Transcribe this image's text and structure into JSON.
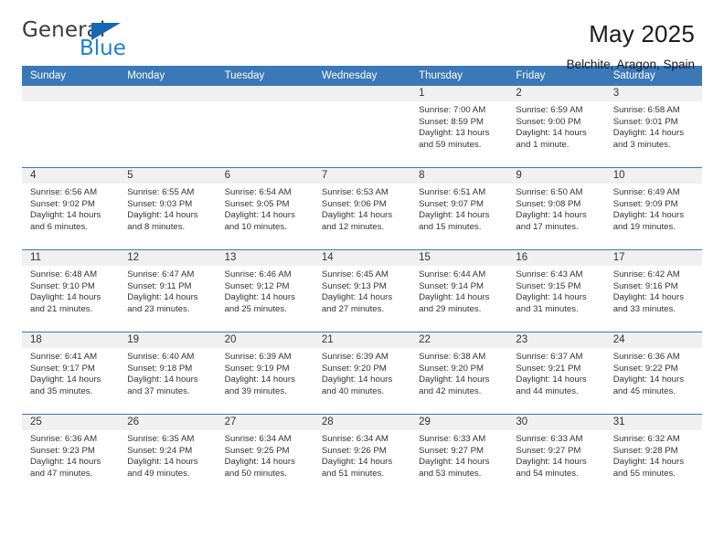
{
  "brand": {
    "name_top": "General",
    "name_bottom": "Blue",
    "accent_color": "#1567b3"
  },
  "header": {
    "title": "May 2025",
    "subtitle": "Belchite, Aragon, Spain"
  },
  "calendar": {
    "header_bg": "#3b78b7",
    "daynum_bg": "#f0f0f0",
    "weekdays": [
      "Sunday",
      "Monday",
      "Tuesday",
      "Wednesday",
      "Thursday",
      "Friday",
      "Saturday"
    ],
    "weeks": [
      [
        {
          "day": "",
          "sunrise": "",
          "sunset": "",
          "daylight": ""
        },
        {
          "day": "",
          "sunrise": "",
          "sunset": "",
          "daylight": ""
        },
        {
          "day": "",
          "sunrise": "",
          "sunset": "",
          "daylight": ""
        },
        {
          "day": "",
          "sunrise": "",
          "sunset": "",
          "daylight": ""
        },
        {
          "day": "1",
          "sunrise": "Sunrise: 7:00 AM",
          "sunset": "Sunset: 8:59 PM",
          "daylight": "Daylight: 13 hours and 59 minutes."
        },
        {
          "day": "2",
          "sunrise": "Sunrise: 6:59 AM",
          "sunset": "Sunset: 9:00 PM",
          "daylight": "Daylight: 14 hours and 1 minute."
        },
        {
          "day": "3",
          "sunrise": "Sunrise: 6:58 AM",
          "sunset": "Sunset: 9:01 PM",
          "daylight": "Daylight: 14 hours and 3 minutes."
        }
      ],
      [
        {
          "day": "4",
          "sunrise": "Sunrise: 6:56 AM",
          "sunset": "Sunset: 9:02 PM",
          "daylight": "Daylight: 14 hours and 6 minutes."
        },
        {
          "day": "5",
          "sunrise": "Sunrise: 6:55 AM",
          "sunset": "Sunset: 9:03 PM",
          "daylight": "Daylight: 14 hours and 8 minutes."
        },
        {
          "day": "6",
          "sunrise": "Sunrise: 6:54 AM",
          "sunset": "Sunset: 9:05 PM",
          "daylight": "Daylight: 14 hours and 10 minutes."
        },
        {
          "day": "7",
          "sunrise": "Sunrise: 6:53 AM",
          "sunset": "Sunset: 9:06 PM",
          "daylight": "Daylight: 14 hours and 12 minutes."
        },
        {
          "day": "8",
          "sunrise": "Sunrise: 6:51 AM",
          "sunset": "Sunset: 9:07 PM",
          "daylight": "Daylight: 14 hours and 15 minutes."
        },
        {
          "day": "9",
          "sunrise": "Sunrise: 6:50 AM",
          "sunset": "Sunset: 9:08 PM",
          "daylight": "Daylight: 14 hours and 17 minutes."
        },
        {
          "day": "10",
          "sunrise": "Sunrise: 6:49 AM",
          "sunset": "Sunset: 9:09 PM",
          "daylight": "Daylight: 14 hours and 19 minutes."
        }
      ],
      [
        {
          "day": "11",
          "sunrise": "Sunrise: 6:48 AM",
          "sunset": "Sunset: 9:10 PM",
          "daylight": "Daylight: 14 hours and 21 minutes."
        },
        {
          "day": "12",
          "sunrise": "Sunrise: 6:47 AM",
          "sunset": "Sunset: 9:11 PM",
          "daylight": "Daylight: 14 hours and 23 minutes."
        },
        {
          "day": "13",
          "sunrise": "Sunrise: 6:46 AM",
          "sunset": "Sunset: 9:12 PM",
          "daylight": "Daylight: 14 hours and 25 minutes."
        },
        {
          "day": "14",
          "sunrise": "Sunrise: 6:45 AM",
          "sunset": "Sunset: 9:13 PM",
          "daylight": "Daylight: 14 hours and 27 minutes."
        },
        {
          "day": "15",
          "sunrise": "Sunrise: 6:44 AM",
          "sunset": "Sunset: 9:14 PM",
          "daylight": "Daylight: 14 hours and 29 minutes."
        },
        {
          "day": "16",
          "sunrise": "Sunrise: 6:43 AM",
          "sunset": "Sunset: 9:15 PM",
          "daylight": "Daylight: 14 hours and 31 minutes."
        },
        {
          "day": "17",
          "sunrise": "Sunrise: 6:42 AM",
          "sunset": "Sunset: 9:16 PM",
          "daylight": "Daylight: 14 hours and 33 minutes."
        }
      ],
      [
        {
          "day": "18",
          "sunrise": "Sunrise: 6:41 AM",
          "sunset": "Sunset: 9:17 PM",
          "daylight": "Daylight: 14 hours and 35 minutes."
        },
        {
          "day": "19",
          "sunrise": "Sunrise: 6:40 AM",
          "sunset": "Sunset: 9:18 PM",
          "daylight": "Daylight: 14 hours and 37 minutes."
        },
        {
          "day": "20",
          "sunrise": "Sunrise: 6:39 AM",
          "sunset": "Sunset: 9:19 PM",
          "daylight": "Daylight: 14 hours and 39 minutes."
        },
        {
          "day": "21",
          "sunrise": "Sunrise: 6:39 AM",
          "sunset": "Sunset: 9:20 PM",
          "daylight": "Daylight: 14 hours and 40 minutes."
        },
        {
          "day": "22",
          "sunrise": "Sunrise: 6:38 AM",
          "sunset": "Sunset: 9:20 PM",
          "daylight": "Daylight: 14 hours and 42 minutes."
        },
        {
          "day": "23",
          "sunrise": "Sunrise: 6:37 AM",
          "sunset": "Sunset: 9:21 PM",
          "daylight": "Daylight: 14 hours and 44 minutes."
        },
        {
          "day": "24",
          "sunrise": "Sunrise: 6:36 AM",
          "sunset": "Sunset: 9:22 PM",
          "daylight": "Daylight: 14 hours and 45 minutes."
        }
      ],
      [
        {
          "day": "25",
          "sunrise": "Sunrise: 6:36 AM",
          "sunset": "Sunset: 9:23 PM",
          "daylight": "Daylight: 14 hours and 47 minutes."
        },
        {
          "day": "26",
          "sunrise": "Sunrise: 6:35 AM",
          "sunset": "Sunset: 9:24 PM",
          "daylight": "Daylight: 14 hours and 49 minutes."
        },
        {
          "day": "27",
          "sunrise": "Sunrise: 6:34 AM",
          "sunset": "Sunset: 9:25 PM",
          "daylight": "Daylight: 14 hours and 50 minutes."
        },
        {
          "day": "28",
          "sunrise": "Sunrise: 6:34 AM",
          "sunset": "Sunset: 9:26 PM",
          "daylight": "Daylight: 14 hours and 51 minutes."
        },
        {
          "day": "29",
          "sunrise": "Sunrise: 6:33 AM",
          "sunset": "Sunset: 9:27 PM",
          "daylight": "Daylight: 14 hours and 53 minutes."
        },
        {
          "day": "30",
          "sunrise": "Sunrise: 6:33 AM",
          "sunset": "Sunset: 9:27 PM",
          "daylight": "Daylight: 14 hours and 54 minutes."
        },
        {
          "day": "31",
          "sunrise": "Sunrise: 6:32 AM",
          "sunset": "Sunset: 9:28 PM",
          "daylight": "Daylight: 14 hours and 55 minutes."
        }
      ]
    ]
  }
}
